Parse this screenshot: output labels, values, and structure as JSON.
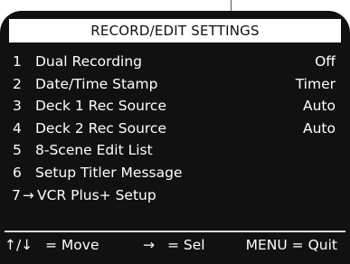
{
  "screen": {
    "title": "RECORD/EDIT SETTINGS"
  },
  "menu": {
    "items": [
      {
        "num": "1",
        "label": "Dual Recording",
        "value": "Off"
      },
      {
        "num": "2",
        "label": "Date/Time Stamp",
        "value": "Timer"
      },
      {
        "num": "3",
        "label": "Deck 1 Rec Source",
        "value": "Auto"
      },
      {
        "num": "4",
        "label": "Deck 2 Rec Source",
        "value": "Auto"
      },
      {
        "num": "5",
        "label": "8-Scene Edit List",
        "value": ""
      },
      {
        "num": "6",
        "label": "Setup Titler Message",
        "value": ""
      },
      {
        "num": "7",
        "label": "VCR Plus+ Setup",
        "value": "",
        "selected_marker": "→"
      }
    ]
  },
  "footer": {
    "nav_arrows": "↑/↓",
    "nav_text": "= Move",
    "select_arrow": "→",
    "select_text": "= Sel",
    "quit_text": "MENU = Quit"
  },
  "colors": {
    "background": "#111111",
    "text": "#ffffff",
    "title_bar": "#ffffff",
    "title_text": "#111111"
  }
}
